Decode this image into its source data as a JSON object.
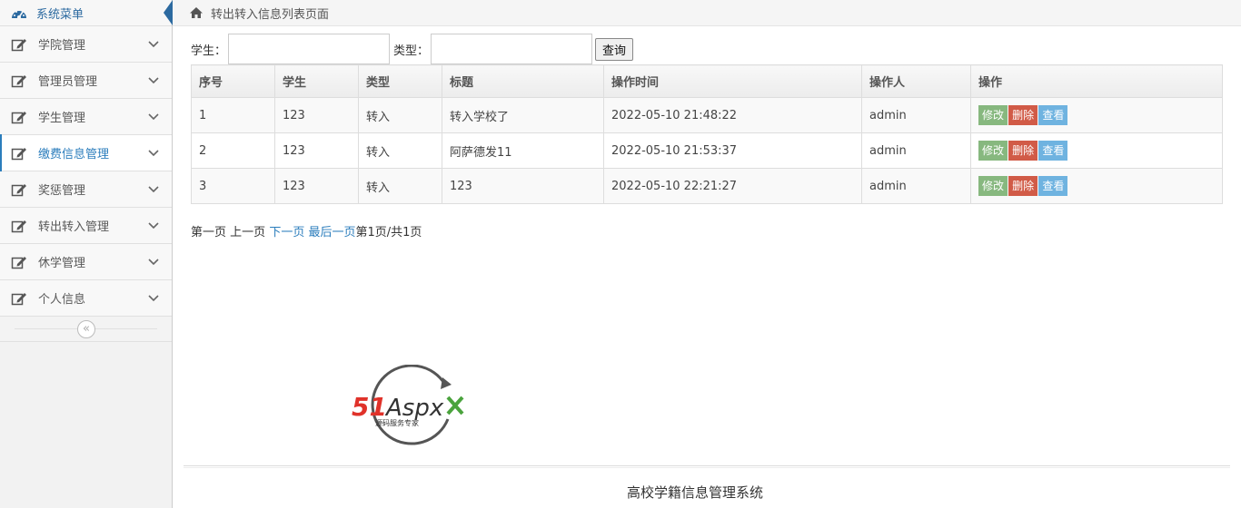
{
  "sidebar": {
    "header": "系统菜单",
    "items": [
      {
        "label": "学院管理"
      },
      {
        "label": "管理员管理"
      },
      {
        "label": "学生管理"
      },
      {
        "label": "缴费信息管理"
      },
      {
        "label": "奖惩管理"
      },
      {
        "label": "转出转入管理"
      },
      {
        "label": "休学管理"
      },
      {
        "label": "个人信息"
      }
    ],
    "collapse_symbol": "«"
  },
  "breadcrumb": {
    "text": "转出转入信息列表页面"
  },
  "search": {
    "student_label": "学生：",
    "type_label": "类型：",
    "student_value": "",
    "type_value": "",
    "query_button": "查询"
  },
  "table": {
    "headers": [
      "序号",
      "学生",
      "类型",
      "标题",
      "操作时间",
      "操作人",
      "操作"
    ],
    "rows": [
      [
        "1",
        "123",
        "转入",
        "转入学校了",
        "2022-05-10 21:48:22",
        "admin"
      ],
      [
        "2",
        "123",
        "转入",
        "阿萨德发11",
        "2022-05-10 21:53:37",
        "admin"
      ],
      [
        "3",
        "123",
        "转入",
        "123",
        "2022-05-10 22:21:27",
        "admin"
      ]
    ],
    "actions": {
      "edit": "修改",
      "delete": "删除",
      "view": "查看"
    }
  },
  "pager": {
    "first": "第一页",
    "prev": "上一页",
    "next": "下一页",
    "last": "最后一页",
    "status": "第1页/共1页"
  },
  "logo": {
    "brand_main": "51",
    "brand_rest": "Aspx",
    "tagline": "源码服务专家"
  },
  "footer": {
    "text": "高校学籍信息管理系统"
  },
  "colors": {
    "accent": "#2b7dbc",
    "edit": "#87b87f",
    "delete": "#d15b47",
    "view": "#6fb3e0",
    "logo_red": "#e0322a",
    "logo_green": "#4aa33d"
  }
}
